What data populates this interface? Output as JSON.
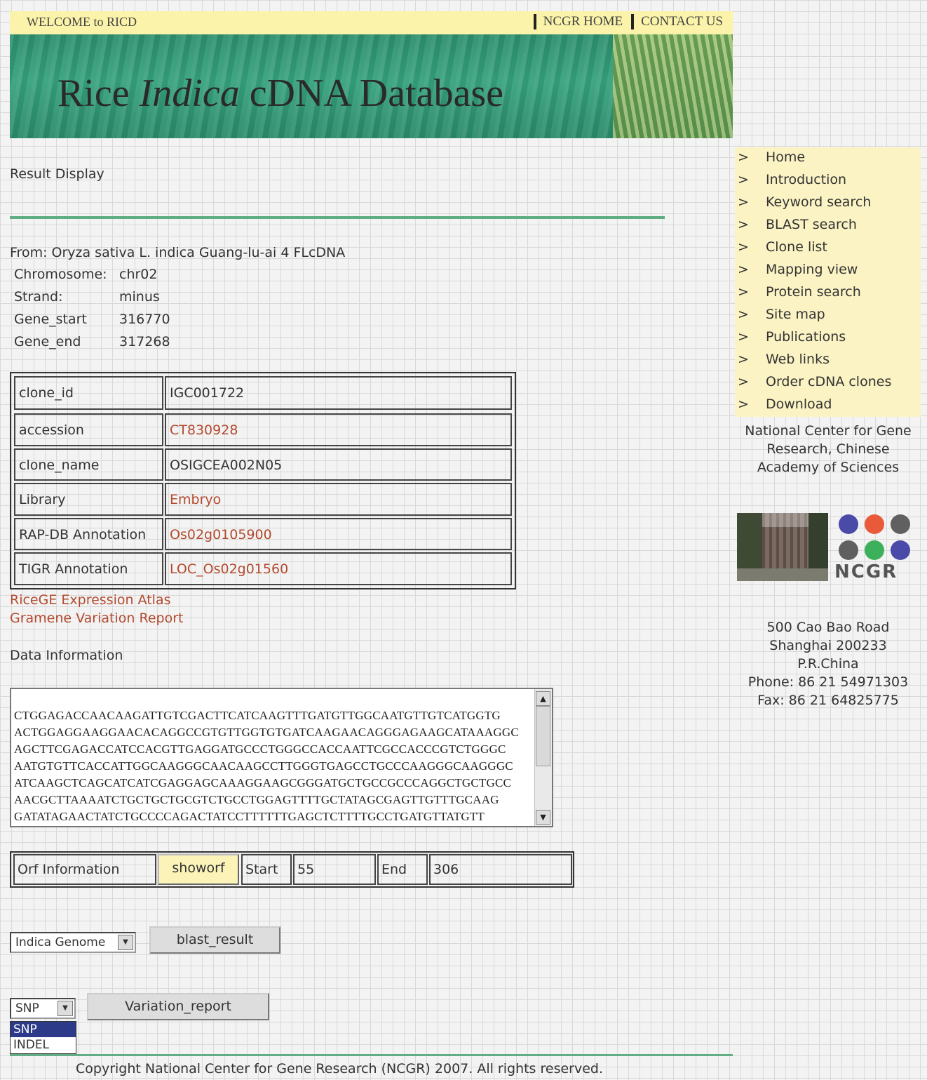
{
  "header": {
    "welcome": "WELCOME to RICD",
    "links": [
      "NCGR HOME",
      "CONTACT US"
    ],
    "banner_title_1": "Rice ",
    "banner_title_italic": "Indica",
    "banner_title_2": " cDNA Database"
  },
  "main": {
    "section_title": "Result Display",
    "from_line": "From: Oryza sativa L. indica Guang-lu-ai 4 FLcDNA",
    "info": [
      {
        "key": "Chromosome:",
        "value": "chr02"
      },
      {
        "key": "Strand:",
        "value": "minus"
      },
      {
        "key": "Gene_start",
        "value": "316770"
      },
      {
        "key": "Gene_end",
        "value": "317268"
      }
    ],
    "table": [
      {
        "label": "clone_id",
        "value": "IGC001722"
      },
      {
        "label": "accession",
        "value": "CT830928"
      },
      {
        "label": "clone_name",
        "value": "OSIGCEA002N05"
      },
      {
        "label": "Library",
        "value": "Embryo"
      },
      {
        "label": "RAP-DB Annotation",
        "value": "Os02g0105900"
      },
      {
        "label": "TIGR Annotation",
        "value": "LOC_Os02g01560"
      }
    ],
    "extra_links": [
      "RiceGE Expression Atlas",
      "Gramene Variation Report"
    ],
    "data_info_title": "Data Information",
    "sequence_lines": [
      "CTGGAGACCAACAAGATTGTCGACTTCATCAAGTTTGATGTTGGCAATGTTGTCATGGTG",
      "ACTGGAGGAAGGAACACAGGCCGTGTTGGTGTGATCAAGAACAGGGAGAAGCATAAAGGC",
      "AGCTTCGAGACCATCCACGTTGAGGATGCCCTGGGCCACCAATTCGCCACCCGTCTGGGC",
      "AATGTGTTCACCATTGGCAAGGGCAACAAGCCTTGGGTGAGCCTGCCCAAGGGCAAGGGC",
      "ATCAAGCTCAGCATCATCGAGGAGCAAAGGAAGCGGGATGCTGCCGCCCAGGCTGCTGCC",
      "AACGCTTAAAATCTGCTGCTGCGTCTGCCTGGAGTTTTGCTATAGCGAGTTGTTTGCAAG",
      "GATATAGAACTATCTGCCCCAGACTATCCTTTTTTGAGCTCTTTTGCCTGATGTTATGTT"
    ],
    "orf": {
      "label": "Orf Information",
      "button": "showorf",
      "start_label": "Start",
      "start_value": "55",
      "end_label": "End",
      "end_value": "306"
    },
    "genome_select": "Indica Genome",
    "blast_button": "blast_result",
    "variation_select": "SNP",
    "variation_button": "Variation_report",
    "variation_options": [
      "SNP",
      "INDEL"
    ]
  },
  "sidebar": {
    "items": [
      {
        "label": "Home"
      },
      {
        "label": "Introduction"
      },
      {
        "label": "Keyword search"
      },
      {
        "label": "BLAST search"
      },
      {
        "label": "Clone list"
      },
      {
        "label": "Mapping view"
      },
      {
        "label": "Protein search"
      },
      {
        "label": "Site map"
      },
      {
        "label": "Publications"
      },
      {
        "label": "Web links"
      },
      {
        "label": "Order cDNA clones"
      },
      {
        "label": "Download"
      }
    ],
    "marker": ">",
    "org_lines": [
      "National Center for Gene",
      "Research, Chinese",
      "Academy of Sciences"
    ],
    "logo_text": "NCGR",
    "logo_colors": [
      "#4a4aa8",
      "#e85a3a",
      "#606060",
      "#606060",
      "#3cb05a",
      "#4a4aa8"
    ],
    "address_lines": [
      "500 Cao Bao Road",
      "Shanghai 200233",
      "P.R.China",
      "Phone: 86 21 54971303",
      "Fax: 86 21 64825775"
    ]
  },
  "footer": {
    "copyright": "Copyright National Center for Gene Research (NCGR) 2007. All rights reserved."
  }
}
